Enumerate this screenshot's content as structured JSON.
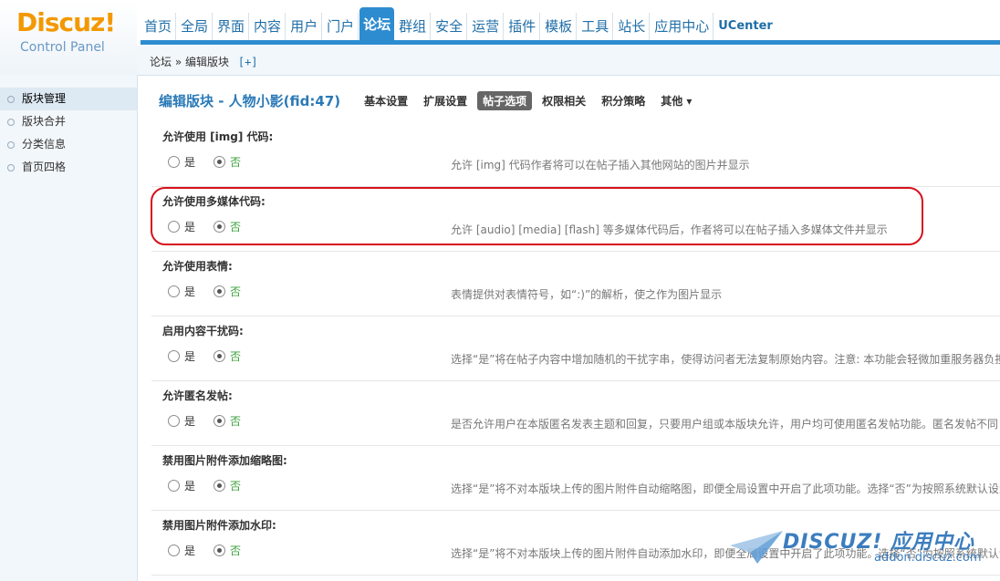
{
  "logo": {
    "brand": "Discuz!",
    "subtitle": "Control Panel"
  },
  "topnav": [
    {
      "label": "首页"
    },
    {
      "label": "全局"
    },
    {
      "label": "界面"
    },
    {
      "label": "内容"
    },
    {
      "label": "用户"
    },
    {
      "label": "门户"
    },
    {
      "label": "论坛",
      "active": true
    },
    {
      "label": "群组"
    },
    {
      "label": "安全"
    },
    {
      "label": "运营"
    },
    {
      "label": "插件"
    },
    {
      "label": "模板"
    },
    {
      "label": "工具"
    },
    {
      "label": "站长"
    },
    {
      "label": "应用中心"
    },
    {
      "label": "UCenter"
    }
  ],
  "breadcrumb": {
    "root": "论坛",
    "sep": "»",
    "current": "编辑版块",
    "add": "[+]"
  },
  "sidebar": {
    "items": [
      {
        "label": "版块管理",
        "active": true
      },
      {
        "label": "版块合并"
      },
      {
        "label": "分类信息"
      },
      {
        "label": "首页四格"
      }
    ]
  },
  "main": {
    "title": "编辑版块 - 人物小影(fid:47)",
    "tabs": [
      {
        "label": "基本设置"
      },
      {
        "label": "扩展设置"
      },
      {
        "label": "帖子选项",
        "active": true
      },
      {
        "label": "权限相关"
      },
      {
        "label": "积分策略"
      },
      {
        "label": "其他 ▾"
      }
    ],
    "yes_label": "是",
    "no_label": "否",
    "settings": [
      {
        "label": "允许使用 [img] 代码:",
        "value": "否",
        "desc": "允许 [img] 代码作者将可以在帖子插入其他网站的图片并显示"
      },
      {
        "label": "允许使用多媒体代码:",
        "value": "否",
        "desc": "允许 [audio] [media] [flash] 等多媒体代码后，作者将可以在帖子插入多媒体文件并显示"
      },
      {
        "label": "允许使用表情:",
        "value": "否",
        "desc": "表情提供对表情符号，如“:)”的解析，使之作为图片显示"
      },
      {
        "label": "启用内容干扰码:",
        "value": "否",
        "desc": "选择“是”将在帖子内容中增加随机的干扰字串，使得访问者无法复制原始内容。注意: 本功能会轻微加重服务器负担"
      },
      {
        "label": "允许匿名发帖:",
        "value": "否",
        "desc": "是否允许用户在本版匿名发表主题和回复，只要用户组或本版块允许，用户均可使用匿名发帖功能。匿名发帖不同"
      },
      {
        "label": "禁用图片附件添加缩略图:",
        "value": "否",
        "desc": "选择“是”将不对本版块上传的图片附件自动缩略图，即便全局设置中开启了此项功能。选择“否”为按照系统默认设置"
      },
      {
        "label": "禁用图片附件添加水印:",
        "value": "否",
        "desc": "选择“是”将不对本版块上传的图片附件自动添加水印，即便全局设置中开启了此项功能。选择“否”为按照系统默认设"
      }
    ]
  },
  "watermark": {
    "text": "DISCUZ! 应用中心",
    "url": "addon.discuz.com"
  },
  "colors": {
    "accent": "#2d8cd0",
    "brand": "#f39800",
    "highlight": "#d7101a",
    "no_option": "#3aa03a"
  }
}
